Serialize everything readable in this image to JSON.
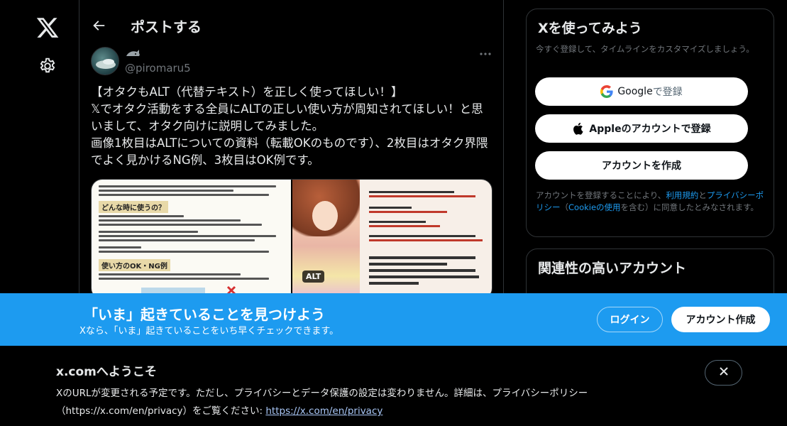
{
  "header": {
    "title": "ポストする"
  },
  "post": {
    "handle": "@piromaru5",
    "text": "【オタクもALT（代替テキスト）を正しく使ってほしい！】\n𝕏でオタク活動をする全員にALTの正しい使い方が周知されてほしい！と思いまして、オタク向けに説明してみました。\n画像1枚目はALTについての資料（転載OKのものです）、2枚目はオタク界隈でよく見かけるNG例、3枚目はOK例です。",
    "media": {
      "left_heading_1": "どんな時に使うの？",
      "left_heading_2": "使い方のOK・NG例",
      "alt_badge": "ALT"
    }
  },
  "signup": {
    "title": "Xを使ってみよう",
    "subtitle": "今すぐ登録して、タイムラインをカスタマイズしましょう。",
    "google_brand": "Google",
    "google_suffix": " で登録",
    "apple_label": "Appleのアカウントで登録",
    "create_label": "アカウントを作成",
    "terms_prefix": "アカウントを登録することにより、",
    "terms_link": "利用規約",
    "terms_and": "と",
    "privacy_link": "プライバシーポリシー",
    "cookie_open": "（",
    "cookie_link": "Cookieの使用",
    "terms_suffix": "を含む）に同意したとみなされます。"
  },
  "related": {
    "title": "関連性の高いアカウント"
  },
  "banner": {
    "title": "「いま」起きていることを見つけよう",
    "subtitle": "Xなら、「いま」起きていることをいち早くチェックできます。",
    "login_label": "ログイン",
    "signup_label": "アカウント作成"
  },
  "notice": {
    "title": "x.comへようこそ",
    "body": "XのURLが変更される予定です。ただし、プライバシーとデータ保護の設定は変わりません。詳細は、プライバシーポリシー（https://x.com/en/privacy）をご覧ください: ",
    "link": "https://x.com/en/privacy"
  },
  "colors": {
    "accent": "#1d9bf0",
    "background": "#000000",
    "text": "#e7e9ea",
    "muted": "#71767b",
    "border": "#2f3336"
  }
}
